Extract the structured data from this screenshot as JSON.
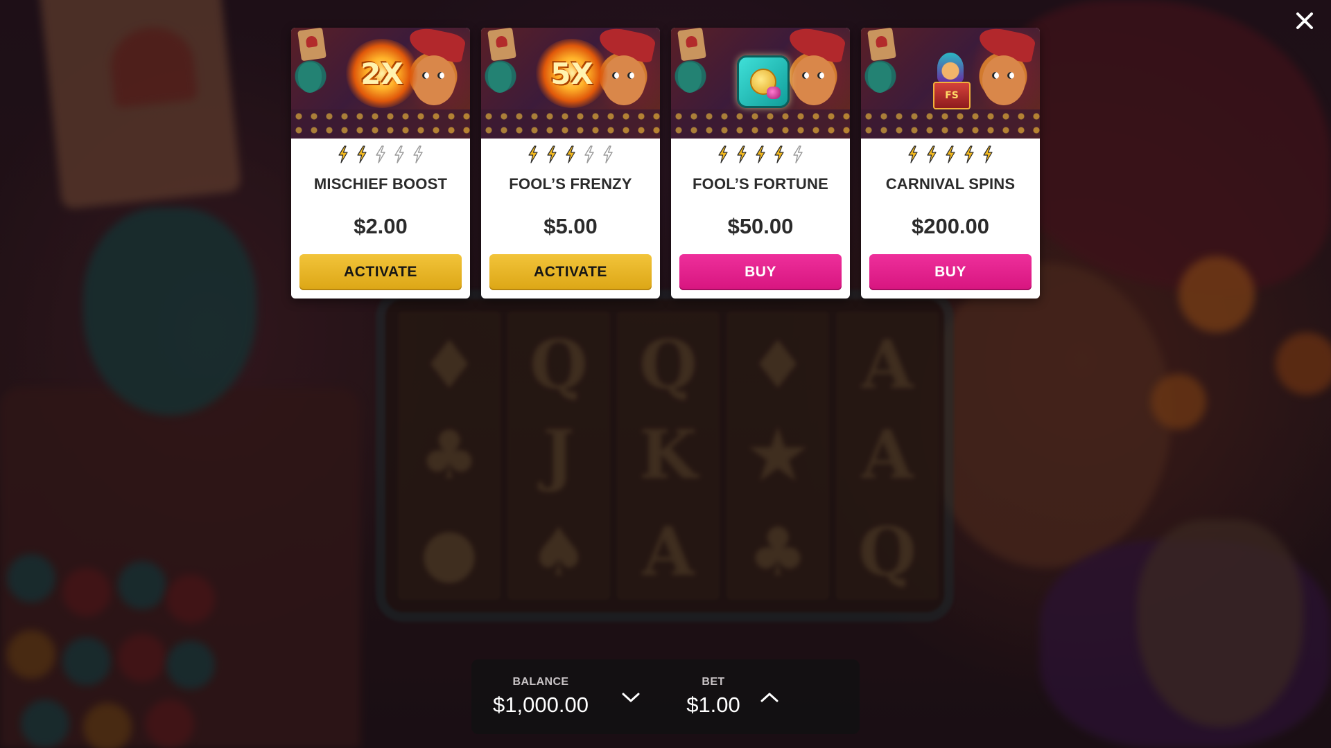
{
  "header": {
    "close_icon": "close-icon"
  },
  "offers": [
    {
      "badge_text": "2X",
      "badge_icon": "multiplier-2x-burst-icon",
      "title": "MISCHIEF BOOST",
      "price": "$2.00",
      "bolts_filled": 2,
      "bolts_total": 5,
      "button_label": "ACTIVATE",
      "button_type": "activate"
    },
    {
      "badge_text": "5X",
      "badge_icon": "multiplier-5x-burst-icon",
      "title": "FOOL’S FRENZY",
      "price": "$5.00",
      "bolts_filled": 3,
      "bolts_total": 5,
      "button_label": "ACTIVATE",
      "button_type": "activate"
    },
    {
      "badge_text": "",
      "badge_icon": "coin-gem-icon",
      "title": "FOOL’S FORTUNE",
      "price": "$50.00",
      "bolts_filled": 4,
      "bolts_total": 5,
      "button_label": "BUY",
      "button_type": "buy"
    },
    {
      "badge_text": "FS",
      "badge_icon": "jack-in-the-box-free-spins-icon",
      "title": "CARNIVAL SPINS",
      "price": "$200.00",
      "bolts_filled": 5,
      "bolts_total": 5,
      "button_label": "BUY",
      "button_type": "buy"
    }
  ],
  "betbar": {
    "balance_label": "BALANCE",
    "balance_value": "$1,000.00",
    "bet_label": "BET",
    "bet_value": "$1.00",
    "decrease_icon": "chevron-down-icon",
    "increase_icon": "chevron-up-icon"
  },
  "colors": {
    "activate": "#e6b323",
    "buy": "#e61e8c",
    "bolt_filled": "#f2b81f",
    "bolt_empty": "#9a9a9a",
    "card_bg": "#ffffff",
    "betbar_bg": "#121012"
  }
}
